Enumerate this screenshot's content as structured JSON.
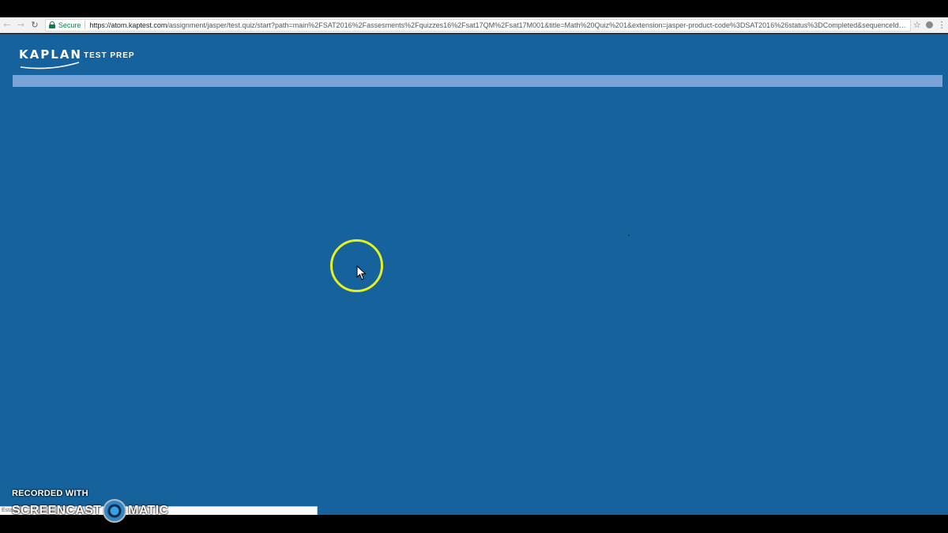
{
  "browser": {
    "back_glyph": "←",
    "forward_glyph": "→",
    "reload_glyph": "↻",
    "secure_label": "Secure",
    "url_host": "https://atom.kaptest.com",
    "url_path": "/assignment/jasper/test.quiz/start?path=main%2FSAT2016%2Fassesments%2Fquizzes16%2Fsat17QM%2Fsat17M001&title=Math%20Quiz%201&extension=jasper-product-code%3DSAT2016%26status%3DCompleted&sequenceId=2258027...",
    "star_glyph": "☆",
    "menu_glyph": "⋮"
  },
  "page": {
    "logo_kaplan": "KAPLAN",
    "logo_testprep": "TEST PREP",
    "progress_percent": 0,
    "background_color": "#15629c",
    "progress_track_color": "#7aa4d9"
  },
  "status_bar": {
    "text": "Esta..."
  },
  "watermark": {
    "line1": "RECORDED WITH",
    "word_left": "SCREENCAST",
    "word_right": "MATIC"
  },
  "icons": {
    "back": "arrow-left-icon",
    "forward": "arrow-right-icon",
    "reload": "reload-icon",
    "secure": "lock-icon",
    "bookmark": "star-icon",
    "extension": "extension-icon",
    "menu": "kebab-menu-icon",
    "cursor": "mouse-pointer-icon"
  },
  "colors": {
    "click_highlight": "#e5f020",
    "secure_green": "#0b8043"
  }
}
